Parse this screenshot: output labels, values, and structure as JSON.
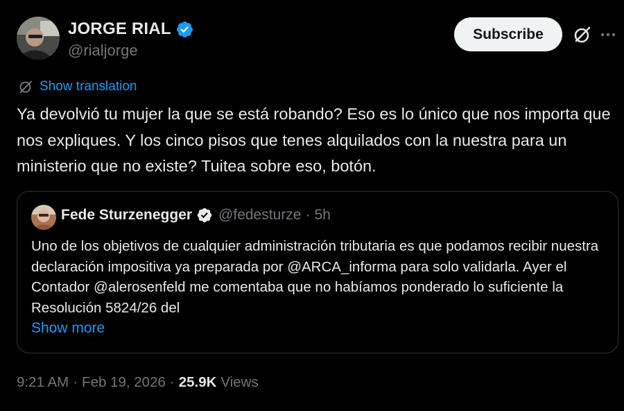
{
  "author": {
    "display_name": "JORGE RIAL",
    "handle": "@rialjorge",
    "verified_icon": "verified-badge-icon"
  },
  "header": {
    "subscribe_label": "Subscribe",
    "grok_icon": "grok-icon",
    "more_icon": "more-options-icon"
  },
  "translation": {
    "label": "Show translation",
    "icon": "translate-icon"
  },
  "tweet": {
    "text": "Ya devolvió tu mujer la que se está robando? Eso es lo único que nos importa que nos expliques. Y los cinco pisos que tenes alquilados con la nuestra para un ministerio que no existe? Tuitea sobre eso, botón."
  },
  "quote": {
    "display_name": "Fede Sturzenegger",
    "handle": "@fedesturze",
    "separator": "·",
    "time": "5h",
    "text": "Uno de los objetivos de cualquier administración tributaria es que podamos recibir nuestra declaración impositiva ya preparada por @ARCA_informa para solo validarla. Ayer el Contador @alerosenfeld me comentaba que no habíamos ponderado lo suficiente la Resolución 5824/26 del",
    "show_more": "Show more"
  },
  "meta": {
    "time": "9:21 AM",
    "separator": "·",
    "date": "Feb 19, 2026",
    "views_count": "25.9K",
    "views_label": "Views"
  },
  "colors": {
    "background": "#000000",
    "text": "#e7e9ea",
    "secondary": "#71767b",
    "link": "#1d9bf0",
    "border": "#2f3336",
    "button_bg": "#eff3f4"
  }
}
